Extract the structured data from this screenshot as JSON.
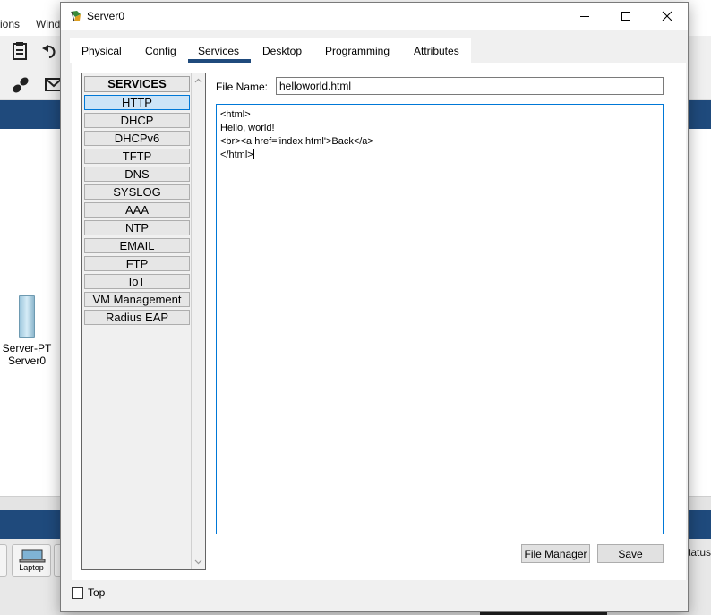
{
  "background": {
    "menu_items": [
      "ions",
      "Wind"
    ],
    "devices": [
      {
        "label_line1": "Server-PT",
        "label_line2": "Server0"
      }
    ],
    "device_thumb_label": "Laptop",
    "status_text": "tatus",
    "colors": {
      "bluebar": "#1f4a7c"
    }
  },
  "dialog": {
    "title": "Server0",
    "app_icon": "packet-tracer-icon",
    "window_buttons": {
      "minimize": "minimize-icon",
      "maximize": "maximize-icon",
      "close": "close-icon"
    },
    "tabs": [
      {
        "label": "Physical"
      },
      {
        "label": "Config"
      },
      {
        "label": "Services",
        "active": true
      },
      {
        "label": "Desktop"
      },
      {
        "label": "Programming"
      },
      {
        "label": "Attributes"
      }
    ],
    "services": {
      "header": "SERVICES",
      "items": [
        {
          "label": "HTTP",
          "selected": true
        },
        {
          "label": "DHCP"
        },
        {
          "label": "DHCPv6"
        },
        {
          "label": "TFTP"
        },
        {
          "label": "DNS"
        },
        {
          "label": "SYSLOG"
        },
        {
          "label": "AAA"
        },
        {
          "label": "NTP"
        },
        {
          "label": "EMAIL"
        },
        {
          "label": "FTP"
        },
        {
          "label": "IoT"
        },
        {
          "label": "VM Management"
        },
        {
          "label": "Radius EAP"
        }
      ]
    },
    "http": {
      "file_name_label": "File Name:",
      "file_name_value": "helloworld.html",
      "content_lines": [
        "<html>",
        "Hello, world!",
        "<br><a href='index.html'>Back</a>",
        "</html>"
      ],
      "file_manager_label": "File Manager",
      "save_label": "Save"
    },
    "footer": {
      "top_label": "Top",
      "top_checked": false
    },
    "colors": {
      "accent": "#1f4a7c",
      "selection": "#cce4f7",
      "focus_border": "#0078d7"
    }
  }
}
